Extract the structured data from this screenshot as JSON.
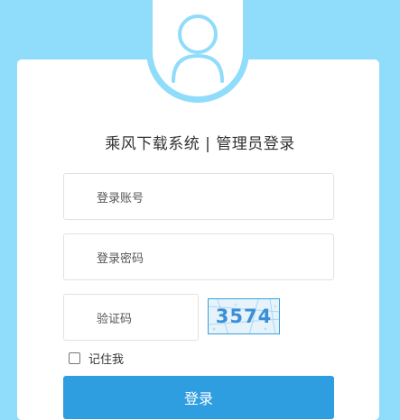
{
  "app": {
    "title": "乘风下载系统 | 管理员登录"
  },
  "form": {
    "username_placeholder": "登录账号",
    "password_placeholder": "登录密码",
    "captcha_placeholder": "验证码",
    "captcha_code": "3574",
    "remember_label": "记住我",
    "login_button": "登录"
  },
  "icons": {
    "avatar": "user-icon"
  },
  "colors": {
    "background": "#8fdcfb",
    "button": "#2f9ee0",
    "card": "#ffffff"
  }
}
